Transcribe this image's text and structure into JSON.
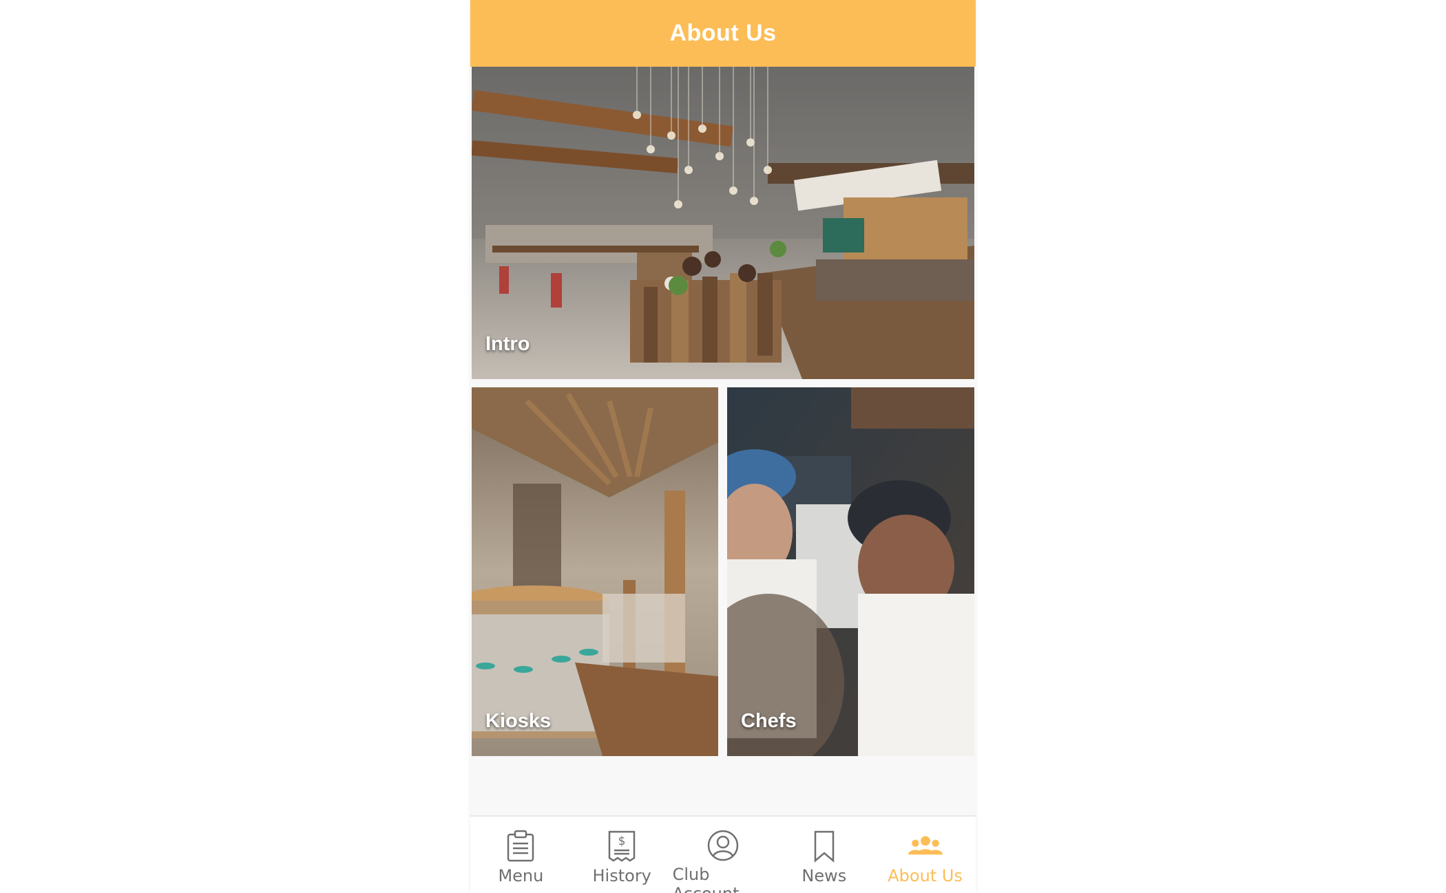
{
  "header": {
    "title": "About Us"
  },
  "tiles": {
    "intro": {
      "label": "Intro"
    },
    "kiosks": {
      "label": "Kiosks"
    },
    "chefs": {
      "label": "Chefs"
    }
  },
  "nav": {
    "items": [
      {
        "label": "Menu",
        "icon": "clipboard-icon"
      },
      {
        "label": "History",
        "icon": "receipt-icon"
      },
      {
        "label": "Club Account",
        "icon": "user-circle-icon"
      },
      {
        "label": "News",
        "icon": "bookmark-icon"
      },
      {
        "label": "About Us",
        "icon": "group-icon"
      }
    ],
    "active_index": 4
  },
  "colors": {
    "accent": "#fcbd56",
    "nav_inactive": "#6f6f6f",
    "background": "#f8f8f8"
  }
}
